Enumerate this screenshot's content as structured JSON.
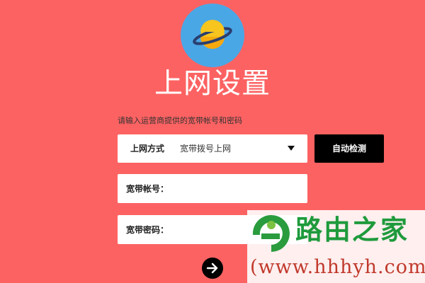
{
  "page": {
    "title": "上网设置",
    "instruction": "请输入运营商提供的宽带帐号和密码",
    "logo_icon": "planet-icon",
    "accent_color": "#fd6262"
  },
  "connection": {
    "label": "上网方式",
    "selected_value": "宽带拨号上网",
    "dropdown_icon": "caret-down-icon"
  },
  "detect_button": {
    "label": "自动检测"
  },
  "account_field": {
    "label": "宽带帐号：",
    "value": ""
  },
  "password_field": {
    "label": "宽带密码：",
    "value": ""
  },
  "next_button": {
    "icon": "arrow-right-icon"
  },
  "watermark": {
    "name": "路由之家",
    "url": "(www.hhhyh.com)"
  }
}
